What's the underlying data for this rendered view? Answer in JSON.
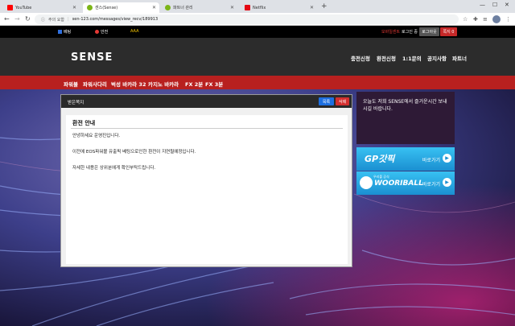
{
  "browser": {
    "tabs": [
      {
        "label": "YouTube",
        "color": "#ff0000"
      },
      {
        "label": "센스(Sense)",
        "color": "#7cb518"
      },
      {
        "label": "파트너 관리",
        "color": "#7cb518"
      },
      {
        "label": "Netflix",
        "color": "#e50914"
      }
    ],
    "address_prefix": "주의 요함",
    "url": "sen-123.com/messages/view_recv/189913"
  },
  "top_strip": {
    "items": [
      {
        "label": "베팅",
        "color": "#2f6fde"
      },
      {
        "label": "안전",
        "color": "#e53935"
      },
      {
        "label": "AAA",
        "color": "#f2c300"
      }
    ],
    "username": "모바일센트",
    "login_text": "로그인 중",
    "buttons": [
      {
        "label": "로그아웃",
        "color": "#555555"
      },
      {
        "label": "쪽지 0",
        "color": "#c62828"
      }
    ]
  },
  "header": {
    "logo": "SENSE",
    "nav": [
      "충전신청",
      "환전신청",
      "1:1문의",
      "공지사항",
      "파트너"
    ]
  },
  "subnav": [
    "파워볼",
    "파워사다리",
    "벅성 바카라 32",
    "카지노 바카라",
    "FX 2분",
    "FX 3분"
  ],
  "message": {
    "panel_title": "받은쪽지",
    "list_button": "목록",
    "delete_button": "삭제",
    "title": "환전 안내",
    "lines": [
      "안녕하세요 운영진입니다.",
      "이전에 EOS파워볼 유출픽 베팅으로인한 환전이 지연될예정입니다.",
      "자세한 내용은 상위분에게 확인부탁드립니다."
    ]
  },
  "promo": {
    "text": "오늘도 저희 SENSE에서 즐거운시간 보내시길 바랍니다."
  },
  "banners": [
    {
      "name": "GP갓픽",
      "go": "바로가기"
    },
    {
      "name": "WOORIBALL",
      "subtitle": "우리볼 공식",
      "go": "바로가기"
    }
  ]
}
